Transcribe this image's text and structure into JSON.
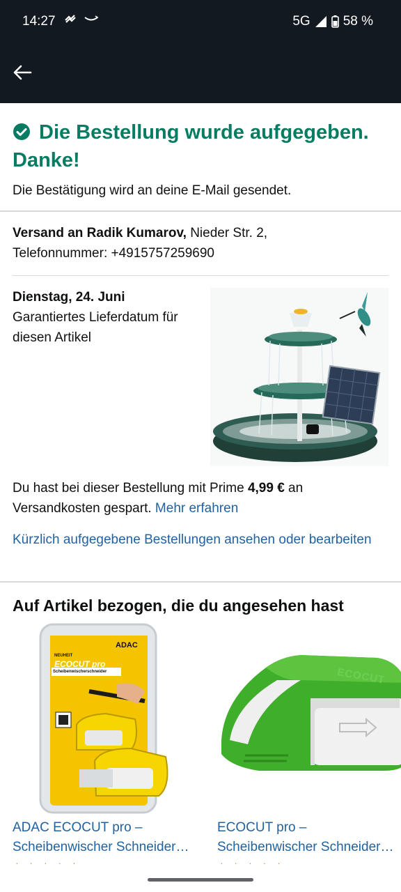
{
  "status_bar": {
    "time": "14:27",
    "network": "5G",
    "battery": "58 %"
  },
  "confirmation": {
    "title": "Die Bestellung wurde aufgegeben. Danke!",
    "subtitle": "Die Bestätigung wird an deine E-Mail gesendet.",
    "accent_color": "#067d62"
  },
  "shipping": {
    "label": "Versand an Radik Kumarov,",
    "address": "Nieder Str. 2,",
    "phone": "Telefonnummer: +4915757259690"
  },
  "delivery": {
    "date": "Dienstag, 24. Juni",
    "description": "Garantiertes Lieferdatum für diesen Artikel"
  },
  "savings": {
    "text_before": "Du hast bei dieser Bestellung mit Prime ",
    "amount": "4,99 €",
    "text_after": " an Versandkosten gespart. ",
    "link": "Mehr erfahren"
  },
  "orders_link": "Kürzlich aufgegebene Bestellungen ansehen oder bearbeiten",
  "related": {
    "title": "Auf Artikel bezogen, die du angesehen hast",
    "items": [
      {
        "title_line1": "ADAC ECOCUT pro –",
        "title_line2": "Scheibenwischer Schneider…",
        "image_labels": {
          "brand": "ADAC",
          "badge": "NEUHEIT",
          "product": "ECOCUT pro",
          "subtitle": "Scheibenwischerschneider"
        }
      },
      {
        "title_line1": "ECOCUT pro –",
        "title_line2": "Scheibenwischer Schneider…",
        "image_labels": {
          "embossed": "ECOCUT"
        }
      }
    ]
  },
  "colors": {
    "header_bg": "#131921",
    "link": "#2162a1",
    "star": "#de7921"
  }
}
